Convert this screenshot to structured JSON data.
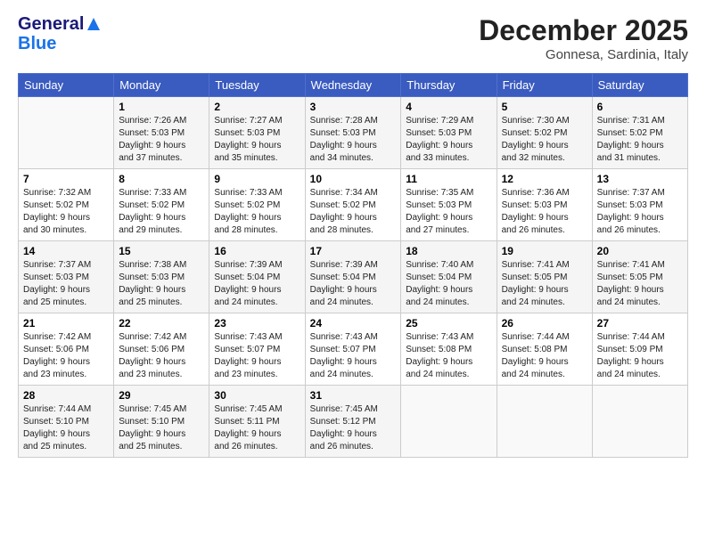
{
  "header": {
    "logo_general": "General",
    "logo_blue": "Blue",
    "month_title": "December 2025",
    "location": "Gonnesa, Sardinia, Italy"
  },
  "days_of_week": [
    "Sunday",
    "Monday",
    "Tuesday",
    "Wednesday",
    "Thursday",
    "Friday",
    "Saturday"
  ],
  "weeks": [
    [
      {
        "day": "",
        "info": ""
      },
      {
        "day": "1",
        "info": "Sunrise: 7:26 AM\nSunset: 5:03 PM\nDaylight: 9 hours\nand 37 minutes."
      },
      {
        "day": "2",
        "info": "Sunrise: 7:27 AM\nSunset: 5:03 PM\nDaylight: 9 hours\nand 35 minutes."
      },
      {
        "day": "3",
        "info": "Sunrise: 7:28 AM\nSunset: 5:03 PM\nDaylight: 9 hours\nand 34 minutes."
      },
      {
        "day": "4",
        "info": "Sunrise: 7:29 AM\nSunset: 5:03 PM\nDaylight: 9 hours\nand 33 minutes."
      },
      {
        "day": "5",
        "info": "Sunrise: 7:30 AM\nSunset: 5:02 PM\nDaylight: 9 hours\nand 32 minutes."
      },
      {
        "day": "6",
        "info": "Sunrise: 7:31 AM\nSunset: 5:02 PM\nDaylight: 9 hours\nand 31 minutes."
      }
    ],
    [
      {
        "day": "7",
        "info": "Sunrise: 7:32 AM\nSunset: 5:02 PM\nDaylight: 9 hours\nand 30 minutes."
      },
      {
        "day": "8",
        "info": "Sunrise: 7:33 AM\nSunset: 5:02 PM\nDaylight: 9 hours\nand 29 minutes."
      },
      {
        "day": "9",
        "info": "Sunrise: 7:33 AM\nSunset: 5:02 PM\nDaylight: 9 hours\nand 28 minutes."
      },
      {
        "day": "10",
        "info": "Sunrise: 7:34 AM\nSunset: 5:02 PM\nDaylight: 9 hours\nand 28 minutes."
      },
      {
        "day": "11",
        "info": "Sunrise: 7:35 AM\nSunset: 5:03 PM\nDaylight: 9 hours\nand 27 minutes."
      },
      {
        "day": "12",
        "info": "Sunrise: 7:36 AM\nSunset: 5:03 PM\nDaylight: 9 hours\nand 26 minutes."
      },
      {
        "day": "13",
        "info": "Sunrise: 7:37 AM\nSunset: 5:03 PM\nDaylight: 9 hours\nand 26 minutes."
      }
    ],
    [
      {
        "day": "14",
        "info": "Sunrise: 7:37 AM\nSunset: 5:03 PM\nDaylight: 9 hours\nand 25 minutes."
      },
      {
        "day": "15",
        "info": "Sunrise: 7:38 AM\nSunset: 5:03 PM\nDaylight: 9 hours\nand 25 minutes."
      },
      {
        "day": "16",
        "info": "Sunrise: 7:39 AM\nSunset: 5:04 PM\nDaylight: 9 hours\nand 24 minutes."
      },
      {
        "day": "17",
        "info": "Sunrise: 7:39 AM\nSunset: 5:04 PM\nDaylight: 9 hours\nand 24 minutes."
      },
      {
        "day": "18",
        "info": "Sunrise: 7:40 AM\nSunset: 5:04 PM\nDaylight: 9 hours\nand 24 minutes."
      },
      {
        "day": "19",
        "info": "Sunrise: 7:41 AM\nSunset: 5:05 PM\nDaylight: 9 hours\nand 24 minutes."
      },
      {
        "day": "20",
        "info": "Sunrise: 7:41 AM\nSunset: 5:05 PM\nDaylight: 9 hours\nand 24 minutes."
      }
    ],
    [
      {
        "day": "21",
        "info": "Sunrise: 7:42 AM\nSunset: 5:06 PM\nDaylight: 9 hours\nand 23 minutes."
      },
      {
        "day": "22",
        "info": "Sunrise: 7:42 AM\nSunset: 5:06 PM\nDaylight: 9 hours\nand 23 minutes."
      },
      {
        "day": "23",
        "info": "Sunrise: 7:43 AM\nSunset: 5:07 PM\nDaylight: 9 hours\nand 23 minutes."
      },
      {
        "day": "24",
        "info": "Sunrise: 7:43 AM\nSunset: 5:07 PM\nDaylight: 9 hours\nand 24 minutes."
      },
      {
        "day": "25",
        "info": "Sunrise: 7:43 AM\nSunset: 5:08 PM\nDaylight: 9 hours\nand 24 minutes."
      },
      {
        "day": "26",
        "info": "Sunrise: 7:44 AM\nSunset: 5:08 PM\nDaylight: 9 hours\nand 24 minutes."
      },
      {
        "day": "27",
        "info": "Sunrise: 7:44 AM\nSunset: 5:09 PM\nDaylight: 9 hours\nand 24 minutes."
      }
    ],
    [
      {
        "day": "28",
        "info": "Sunrise: 7:44 AM\nSunset: 5:10 PM\nDaylight: 9 hours\nand 25 minutes."
      },
      {
        "day": "29",
        "info": "Sunrise: 7:45 AM\nSunset: 5:10 PM\nDaylight: 9 hours\nand 25 minutes."
      },
      {
        "day": "30",
        "info": "Sunrise: 7:45 AM\nSunset: 5:11 PM\nDaylight: 9 hours\nand 26 minutes."
      },
      {
        "day": "31",
        "info": "Sunrise: 7:45 AM\nSunset: 5:12 PM\nDaylight: 9 hours\nand 26 minutes."
      },
      {
        "day": "",
        "info": ""
      },
      {
        "day": "",
        "info": ""
      },
      {
        "day": "",
        "info": ""
      }
    ]
  ]
}
